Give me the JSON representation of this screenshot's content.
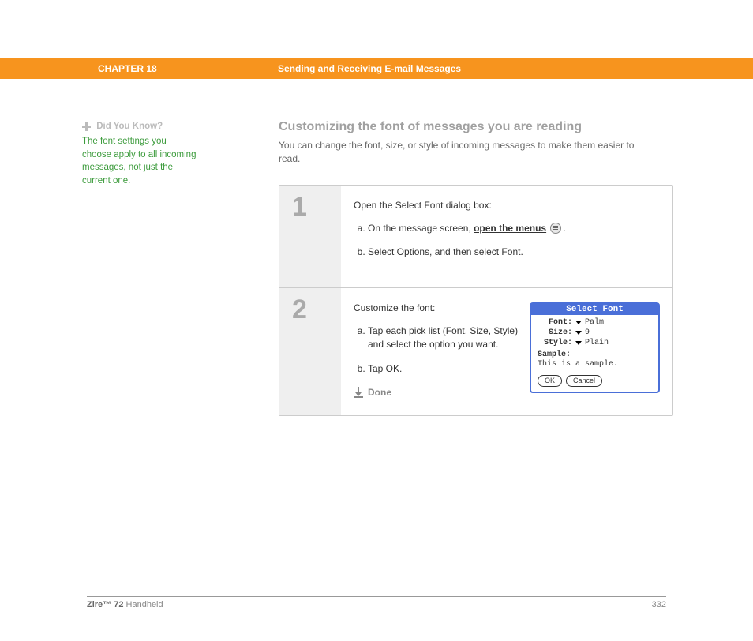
{
  "header": {
    "chapter": "CHAPTER 18",
    "title": "Sending and Receiving E-mail Messages"
  },
  "sidebar": {
    "dyk_title": "Did You Know?",
    "dyk_body": "The font settings you choose apply to all incoming messages, not just the current one."
  },
  "section": {
    "heading": "Customizing the font of messages you are reading",
    "intro": "You can change the font, size, or style of incoming messages to make them easier to read."
  },
  "steps": [
    {
      "num": "1",
      "lead": "Open the Select Font dialog box:",
      "items": [
        {
          "prefix": "On the message screen, ",
          "link": "open the menus",
          "suffix": "."
        },
        {
          "text": "Select Options, and then select Font."
        }
      ]
    },
    {
      "num": "2",
      "lead": "Customize the font:",
      "items": [
        {
          "text": "Tap each pick list (Font, Size, Style) and select the option you want."
        },
        {
          "text": "Tap OK."
        }
      ],
      "done": "Done"
    }
  ],
  "dialog": {
    "title": "Select Font",
    "rows": [
      {
        "label": "Font:",
        "value": "Palm"
      },
      {
        "label": "Size:",
        "value": "9"
      },
      {
        "label": "Style:",
        "value": "Plain"
      }
    ],
    "sample_label": "Sample:",
    "sample_text": "This is a sample.",
    "ok": "OK",
    "cancel": "Cancel"
  },
  "footer": {
    "product_bold": "Zire™ 72",
    "product_rest": " Handheld",
    "page": "332"
  }
}
